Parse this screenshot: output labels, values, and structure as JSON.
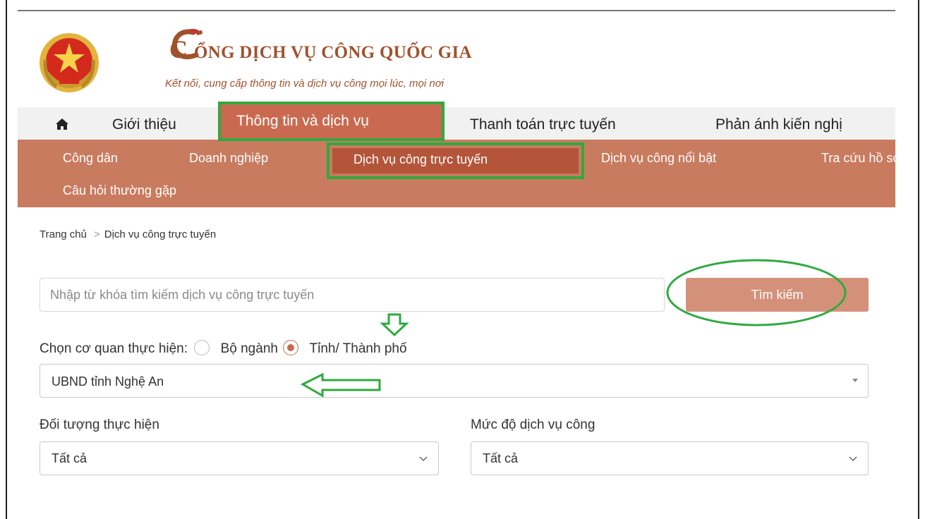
{
  "header": {
    "title": "CỔNG DỊCH VỤ CÔNG QUỐC GIA",
    "title_initial": "C",
    "title_rest": "ỔNG DỊCH VỤ CÔNG QUỐC GIA",
    "slogan": "Kết nối, cung cấp thông tin và dịch vụ công mọi lúc, mọi nơi"
  },
  "main_nav": {
    "home_icon": "home-icon",
    "items": [
      {
        "label": "Giới thiệu"
      },
      {
        "label": "Thông tin và dịch vụ",
        "active": true
      },
      {
        "label": "Thanh toán trực tuyến"
      },
      {
        "label": "Phản ánh kiến nghị"
      }
    ]
  },
  "sub_nav": {
    "items": [
      {
        "label": "Công dân"
      },
      {
        "label": "Doanh nghiệp"
      },
      {
        "label": "Dịch vụ công trực tuyến",
        "active": true
      },
      {
        "label": "Dịch vụ công nổi bật"
      },
      {
        "label": "Tra cứu hồ sơ"
      },
      {
        "label": "Câu hỏi thường gặp"
      }
    ]
  },
  "breadcrumb": {
    "home": "Trang chủ",
    "separator": ">",
    "current": "Dịch vụ công trực tuyến"
  },
  "search": {
    "placeholder": "Nhập từ khóa tìm kiếm dịch vụ công trực tuyến",
    "value": "",
    "button_label": "Tìm kiếm"
  },
  "agency": {
    "label": "Chọn cơ quan thực hiện:",
    "options": [
      {
        "label": "Bộ ngành",
        "checked": false
      },
      {
        "label": "Tỉnh/ Thành phố",
        "checked": true
      }
    ],
    "selected": "UBND tỉnh Nghệ An"
  },
  "filters": {
    "target": {
      "label": "Đối tượng thực hiện",
      "value": "Tất cả"
    },
    "level": {
      "label": "Mức độ dịch vụ công",
      "value": "Tất cả"
    }
  },
  "colors": {
    "brand": "#a0522d",
    "nav_active": "#c96a50",
    "subnav_bg": "#c97b5f",
    "subnav_active": "#b4553a",
    "button": "#d4917a",
    "annotation_green": "#2faa3f"
  }
}
